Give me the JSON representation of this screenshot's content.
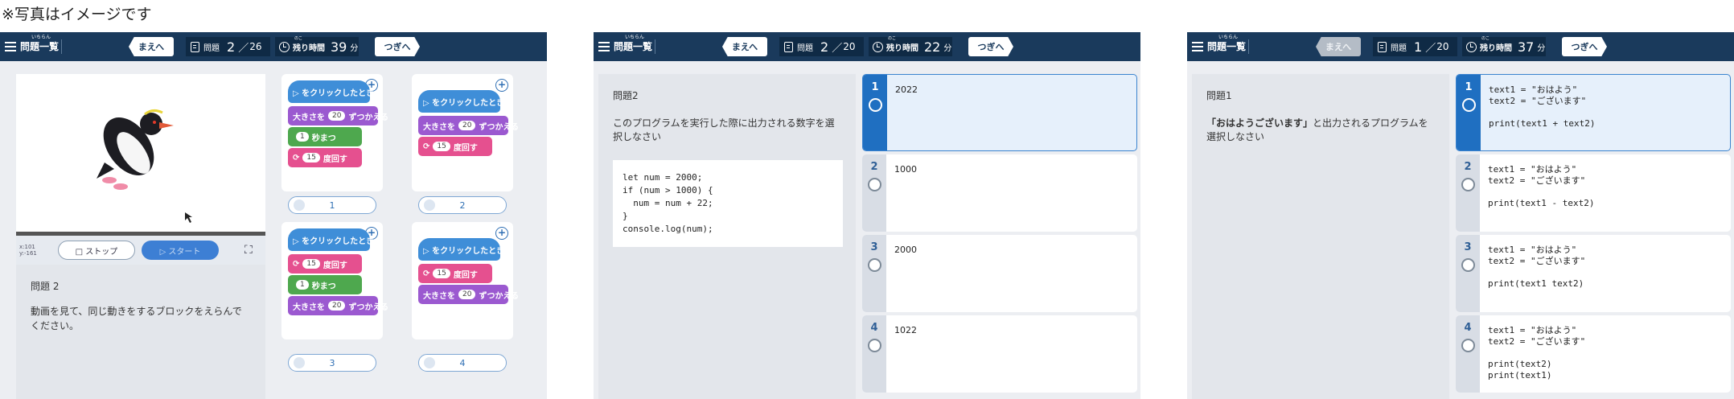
{
  "note": "※写真はイメージです",
  "common": {
    "menu_label": "問題一覧",
    "menu_ruby": "いちらん",
    "prev_label": "まえへ",
    "next_label": "つぎへ",
    "q_label": "問題",
    "q_sep": "／",
    "time_label": "残り時間",
    "time_ruby": "のこ",
    "time_unit": "分"
  },
  "screens": [
    {
      "q_current": "2",
      "q_total": "26",
      "time_left": "39",
      "video": {
        "coords": "x:101\ny:-161",
        "stop_label": "□ ストップ",
        "start_label": "▷ スタート"
      },
      "question": {
        "title": "問題 2",
        "text": "動画を見て、同じ動きをするブロックをえらんでください。"
      },
      "cards": [
        {
          "option": "1",
          "blocks": [
            {
              "type": "ev",
              "text": "▷ をクリックしたとき"
            },
            {
              "type": "sz",
              "pre": "大きさを",
              "val": "20",
              "post": "ずつかえる"
            },
            {
              "type": "wt",
              "pre": "",
              "val": "1",
              "post": "秒まつ"
            },
            {
              "type": "rt",
              "pre": "⟳",
              "val": "15",
              "post": "度回す"
            }
          ]
        },
        {
          "option": "2",
          "blocks": [
            {
              "type": "ev",
              "text": "▷ をクリックしたとき"
            },
            {
              "type": "sz",
              "pre": "大きさを",
              "val": "20",
              "post": "ずつかえる"
            },
            {
              "type": "rt",
              "pre": "⟳",
              "val": "15",
              "post": "度回す"
            }
          ]
        },
        {
          "option": "3",
          "blocks": [
            {
              "type": "ev",
              "text": "▷ をクリックしたとき"
            },
            {
              "type": "rt",
              "pre": "⟳",
              "val": "15",
              "post": "度回す"
            },
            {
              "type": "wt",
              "pre": "",
              "val": "1",
              "post": "秒まつ"
            },
            {
              "type": "sz",
              "pre": "大きさを",
              "val": "20",
              "post": "ずつかえる"
            }
          ]
        },
        {
          "option": "4",
          "blocks": [
            {
              "type": "ev",
              "text": "▷ をクリックしたとき"
            },
            {
              "type": "rt",
              "pre": "⟳",
              "val": "15",
              "post": "度回す"
            },
            {
              "type": "sz",
              "pre": "大きさを",
              "val": "20",
              "post": "ずつかえる"
            }
          ]
        }
      ]
    },
    {
      "q_current": "2",
      "q_total": "20",
      "time_left": "22",
      "question": {
        "title": "問題2",
        "text": "このプログラムを実行した際に出力される数字を選択しなさい",
        "code": "let num = 2000;\nif (num > 1000) {\n  num = num + 22;\n}\nconsole.log(num);"
      },
      "answers": [
        {
          "num": "1",
          "text": "2022",
          "selected": true
        },
        {
          "num": "2",
          "text": "1000",
          "selected": false
        },
        {
          "num": "3",
          "text": "2000",
          "selected": false
        },
        {
          "num": "4",
          "text": "1022",
          "selected": false
        }
      ]
    },
    {
      "q_current": "1",
      "q_total": "20",
      "time_left": "37",
      "prev_disabled": true,
      "question": {
        "title": "問題1",
        "text_bold": "「おはようございます」",
        "text_rest": "と出力されるプログラムを選択しなさい"
      },
      "answers": [
        {
          "num": "1",
          "code": "text1 = \"おはよう\"\ntext2 = \"ございます\"\n\nprint(text1 + text2)",
          "selected": true
        },
        {
          "num": "2",
          "code": "text1 = \"おはよう\"\ntext2 = \"ございます\"\n\nprint(text1 - text2)",
          "selected": false
        },
        {
          "num": "3",
          "code": "text1 = \"おはよう\"\ntext2 = \"ございます\"\n\nprint(text1 text2)",
          "selected": false
        },
        {
          "num": "4",
          "code": "text1 = \"おはよう\"\ntext2 = \"ございます\"\n\nprint(text2)\nprint(text1)",
          "selected": false
        }
      ]
    }
  ]
}
